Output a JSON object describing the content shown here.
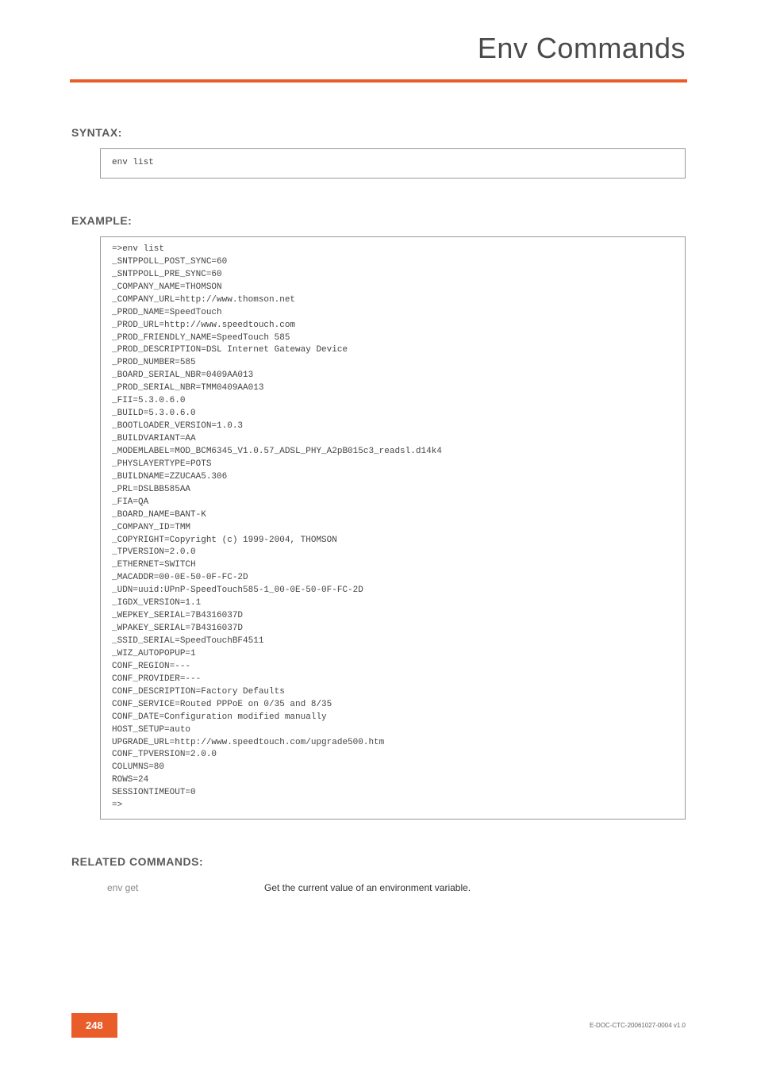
{
  "header": {
    "title": "Env Commands"
  },
  "sections": {
    "syntax": {
      "label": "SYNTAX:",
      "code": "env list"
    },
    "example": {
      "label": "EXAMPLE:",
      "code": "=>env list\n_SNTPPOLL_POST_SYNC=60\n_SNTPPOLL_PRE_SYNC=60\n_COMPANY_NAME=THOMSON\n_COMPANY_URL=http://www.thomson.net\n_PROD_NAME=SpeedTouch\n_PROD_URL=http://www.speedtouch.com\n_PROD_FRIENDLY_NAME=SpeedTouch 585\n_PROD_DESCRIPTION=DSL Internet Gateway Device\n_PROD_NUMBER=585\n_BOARD_SERIAL_NBR=0409AA013\n_PROD_SERIAL_NBR=TMM0409AA013\n_FII=5.3.0.6.0\n_BUILD=5.3.0.6.0\n_BOOTLOADER_VERSION=1.0.3\n_BUILDVARIANT=AA\n_MODEMLABEL=MOD_BCM6345_V1.0.57_ADSL_PHY_A2pB015c3_readsl.d14k4\n_PHYSLAYERTYPE=POTS\n_BUILDNAME=ZZUCAA5.306\n_PRL=DSLBB585AA\n_FIA=QA\n_BOARD_NAME=BANT-K\n_COMPANY_ID=TMM\n_COPYRIGHT=Copyright (c) 1999-2004, THOMSON\n_TPVERSION=2.0.0\n_ETHERNET=SWITCH\n_MACADDR=00-0E-50-0F-FC-2D\n_UDN=uuid:UPnP-SpeedTouch585-1_00-0E-50-0F-FC-2D\n_IGDX_VERSION=1.1\n_WEPKEY_SERIAL=7B4316037D\n_WPAKEY_SERIAL=7B4316037D\n_SSID_SERIAL=SpeedTouchBF4511\n_WIZ_AUTOPOPUP=1\nCONF_REGION=---\nCONF_PROVIDER=---\nCONF_DESCRIPTION=Factory Defaults\nCONF_SERVICE=Routed PPPoE on 0/35 and 8/35\nCONF_DATE=Configuration modified manually\nHOST_SETUP=auto\nUPGRADE_URL=http://www.speedtouch.com/upgrade500.htm\nCONF_TPVERSION=2.0.0\nCOLUMNS=80\nROWS=24\nSESSIONTIMEOUT=0\n=>"
    },
    "related": {
      "label": "RELATED COMMANDS:",
      "rows": [
        {
          "cmd": "env get",
          "desc": "Get the current value of an environment variable."
        }
      ]
    }
  },
  "footer": {
    "page": "248",
    "docid": "E-DOC-CTC-20061027-0004 v1.0"
  }
}
